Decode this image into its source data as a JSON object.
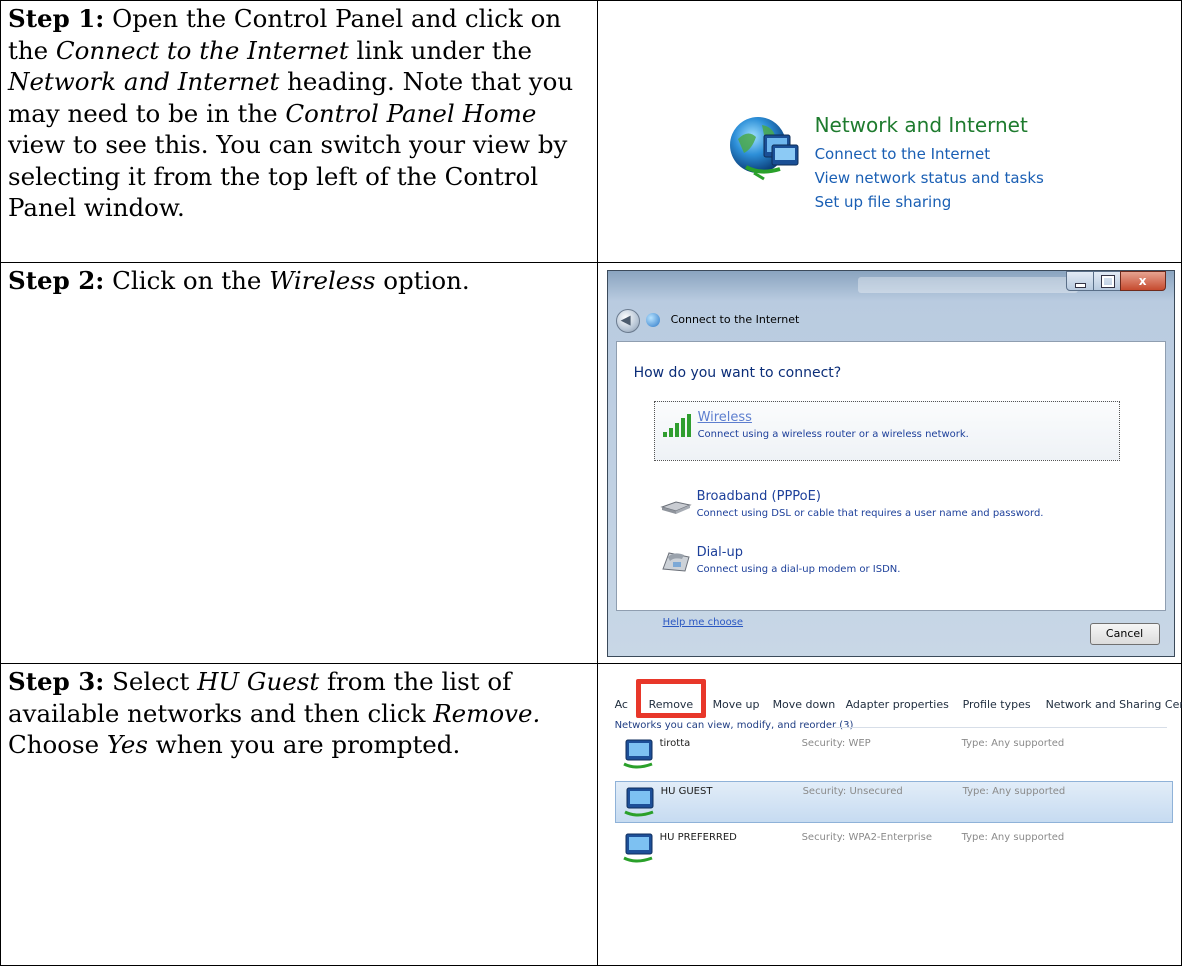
{
  "steps": [
    {
      "label": "Step 1:",
      "parts": [
        " Open the Control Panel and click on the ",
        "Connect to the Internet",
        " link under the ",
        "Network and Internet",
        " heading. Note that you may need to be in the ",
        "Control Panel Home",
        " view to see this. You can switch your view by selecting it from the top left of the Control Panel window."
      ]
    },
    {
      "label": "Step 2:",
      "parts": [
        " Click on the ",
        "Wireless",
        " option."
      ]
    },
    {
      "label": "Step 3:",
      "parts": [
        " Select ",
        "HU Guest",
        " from the list of available networks and then click ",
        "Remove.",
        " Choose ",
        "Yes",
        " when you are prompted."
      ]
    }
  ],
  "network_panel": {
    "icon": "network-globe-icon",
    "heading": "Network and Internet",
    "links": [
      "Connect to the Internet",
      "View network status and tasks",
      "Set up file sharing"
    ],
    "heading_color": "#1e7b2e",
    "link_color": "#1a5fb4"
  },
  "connect_dialog": {
    "title": "Connect to the Internet",
    "question": "How do you want to connect?",
    "options": [
      {
        "title": "Wireless",
        "desc": "Connect using a wireless router or a wireless network.",
        "icon": "wireless-signal-icon"
      },
      {
        "title": "Broadband (PPPoE)",
        "desc": "Connect using DSL or cable that requires a user name and password.",
        "icon": "modem-icon"
      },
      {
        "title": "Dial-up",
        "desc": "Connect using a dial-up modem or ISDN.",
        "icon": "dialup-phone-icon"
      }
    ],
    "help_link": "Help me choose",
    "cancel": "Cancel",
    "close_glyph": "x"
  },
  "manage_wireless": {
    "toolbar": {
      "add_partial": "Ac",
      "remove": "Remove",
      "move_up": "Move up",
      "move_down": "Move down",
      "adapter": "Adapter properties",
      "profile": "Profile types",
      "sharing": "Network and Sharing Center"
    },
    "group_header": "Networks you can view, modify, and reorder (3)",
    "networks": [
      {
        "name": "tirotta",
        "security": "Security: WEP",
        "type": "Type: Any supported"
      },
      {
        "name": "HU GUEST",
        "security": "Security: Unsecured",
        "type": "Type: Any supported"
      },
      {
        "name": "HU PREFERRED",
        "security": "Security: WPA2-Enterprise",
        "type": "Type: Any supported"
      }
    ],
    "highlight_color": "#e8372a"
  }
}
